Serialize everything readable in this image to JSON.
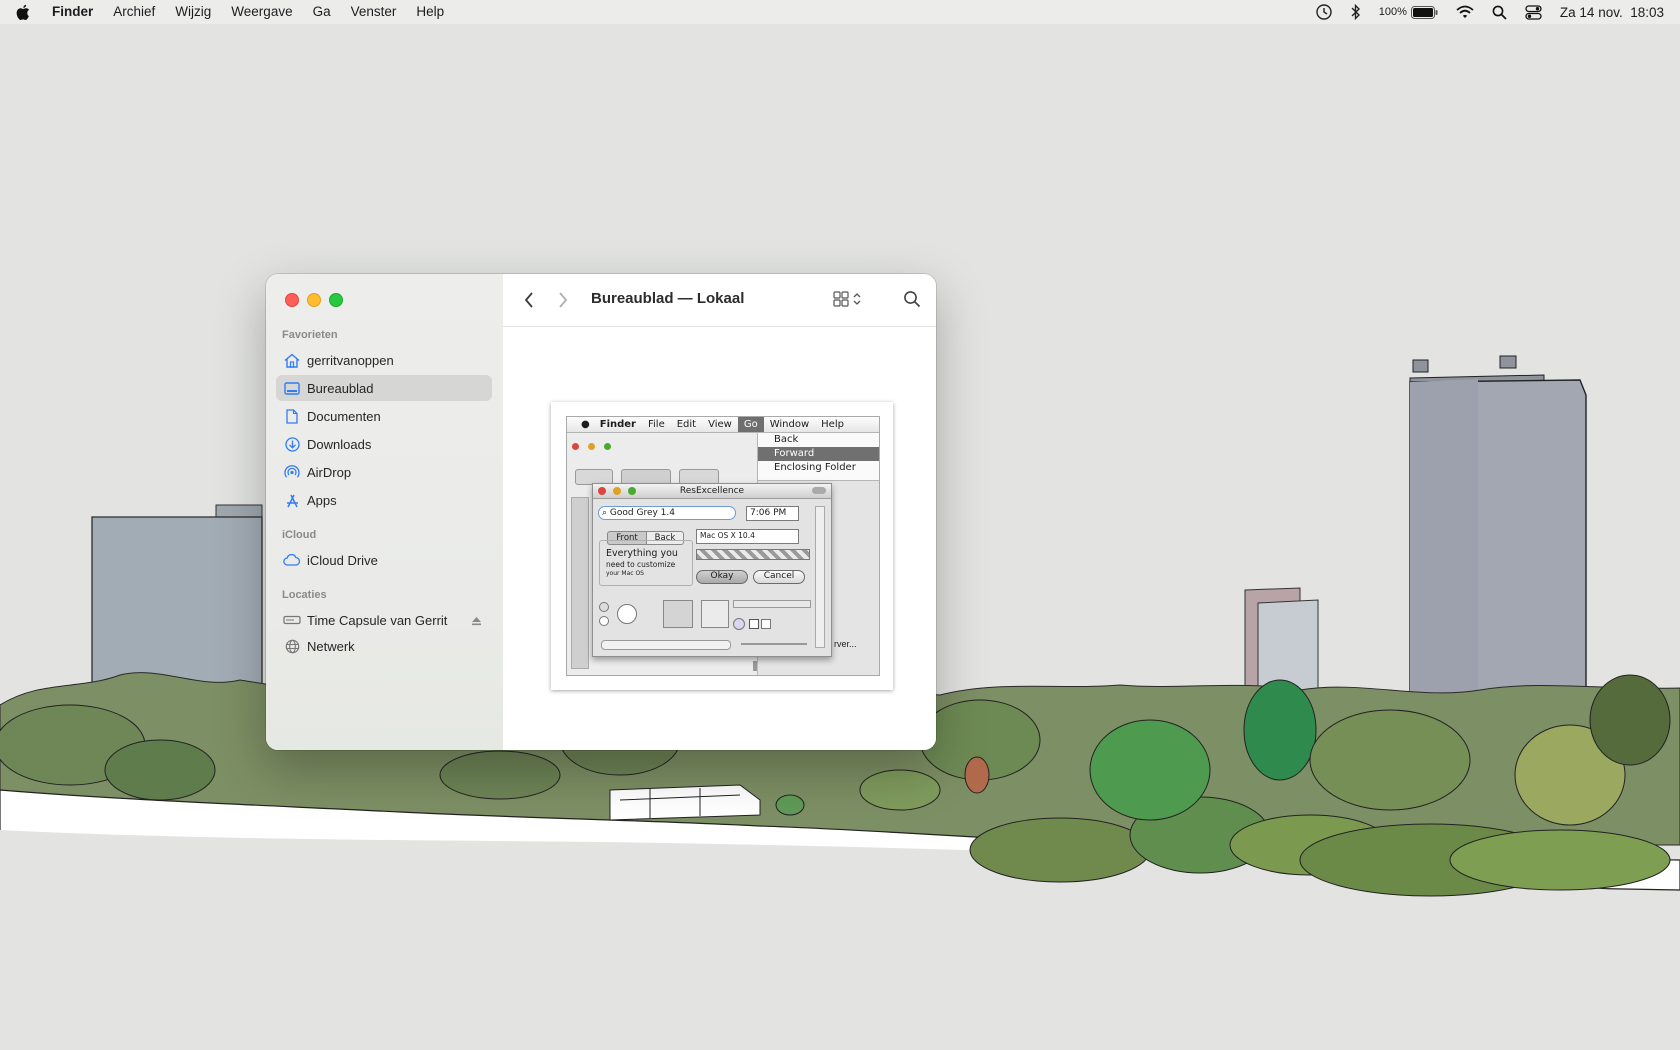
{
  "menubar": {
    "app_name": "Finder",
    "items": [
      "Archief",
      "Wijzig",
      "Weergave",
      "Ga",
      "Venster",
      "Help"
    ],
    "battery_percent": "100%",
    "clock": "Za 14 nov.  18:03"
  },
  "window": {
    "title": "Bureaublad — Lokaal",
    "sidebar": {
      "favorites_header": "Favorieten",
      "favorites": [
        {
          "label": "gerritvanoppen",
          "icon": "house-icon"
        },
        {
          "label": "Bureaublad",
          "icon": "desktop-icon",
          "selected": true
        },
        {
          "label": "Documenten",
          "icon": "document-icon"
        },
        {
          "label": "Downloads",
          "icon": "download-icon"
        },
        {
          "label": "AirDrop",
          "icon": "airdrop-icon"
        },
        {
          "label": "Apps",
          "icon": "apps-icon"
        }
      ],
      "icloud_header": "iCloud",
      "icloud": [
        {
          "label": "iCloud Drive",
          "icon": "cloud-icon"
        }
      ],
      "locations_header": "Locaties",
      "locations": [
        {
          "label": "Time Capsule van Gerrit",
          "icon": "drive-icon"
        },
        {
          "label": "Netwerk",
          "icon": "globe-icon"
        }
      ]
    }
  },
  "thumbnail": {
    "menubar": [
      "Finder",
      "File",
      "Edit",
      "View",
      "Go",
      "Window",
      "Help"
    ],
    "go_menu": [
      "Back",
      "Forward",
      "Enclosing Folder"
    ],
    "dialog_title": "ResExcellence",
    "search_value": "Good Grey 1.4",
    "time_value": "7:06 PM",
    "tab_front": "Front",
    "tab_back": "Back",
    "popup_value": "Mac OS X 10.4",
    "text_big": "Everything you",
    "text_mid": "need to customize",
    "text_small": "your Mac OS",
    "okay": "Okay",
    "cancel": "Cancel",
    "partial_text": "rver..."
  }
}
